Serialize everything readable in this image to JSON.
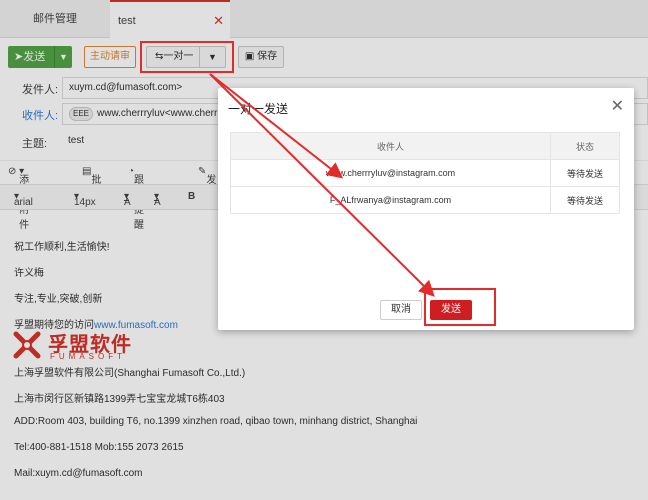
{
  "tabs": [
    {
      "label": "邮件管理"
    },
    {
      "label": "test",
      "close": "✕"
    }
  ],
  "toolbar": {
    "send_label": "发送",
    "apply_label": "主动请审",
    "one_to_one_label": "一对一",
    "save_label": "保存"
  },
  "header": {
    "from_label": "发件人:",
    "from_value": "xuym.cd@fumasoft.com>",
    "to_label": "收件人:",
    "to_chip": "EEE",
    "to_value": "www.cherrryluv<www.cherrryluv@",
    "subject_label": "主题:",
    "subject_value": "test"
  },
  "editor_toolbar": {
    "attach": "添加附件",
    "batch": "批注",
    "remind": "跟踪提醒",
    "more": "发"
  },
  "format_bar": {
    "font": "arial",
    "size": "14px",
    "color_a": "A",
    "bg_a": "A",
    "bold": "B"
  },
  "body_lines": [
    "祝工作顺利,生活愉快!",
    "许义梅",
    "专注,专业,突破,创新",
    "孚盟期待您的访问",
    "www.fumasoft.com",
    "上海孚盟软件有限公司(Shanghai  Fumasoft Co.,Ltd.)",
    "上海市闵行区新镇路1399弄七宝宝龙城T6栋403",
    "ADD:Room 403, building T6, no.1399 xinzhen road, qibao town, minhang district, Shanghai",
    "Tel:400-881-1518        Mob:155 2073 2615",
    "Mail:xuym.cd@fumasoft.com"
  ],
  "logo": {
    "name": "孚盟软件",
    "sub": "FUMASOFT"
  },
  "dialog": {
    "title": "一对一发送",
    "close": "✕",
    "col_recipient": "收件人",
    "col_status": "状态",
    "rows": [
      {
        "recipient": "www.cherrryluv@instagram.com",
        "status": "等待发送"
      },
      {
        "recipient": "F_ALfrwanya@instagram.com",
        "status": "等待发送"
      }
    ],
    "cancel_label": "取消",
    "send_label": "发送"
  },
  "colors": {
    "accent_red": "#cf1d22",
    "annotation_red": "#e52a2a",
    "send_green": "#52a447"
  }
}
